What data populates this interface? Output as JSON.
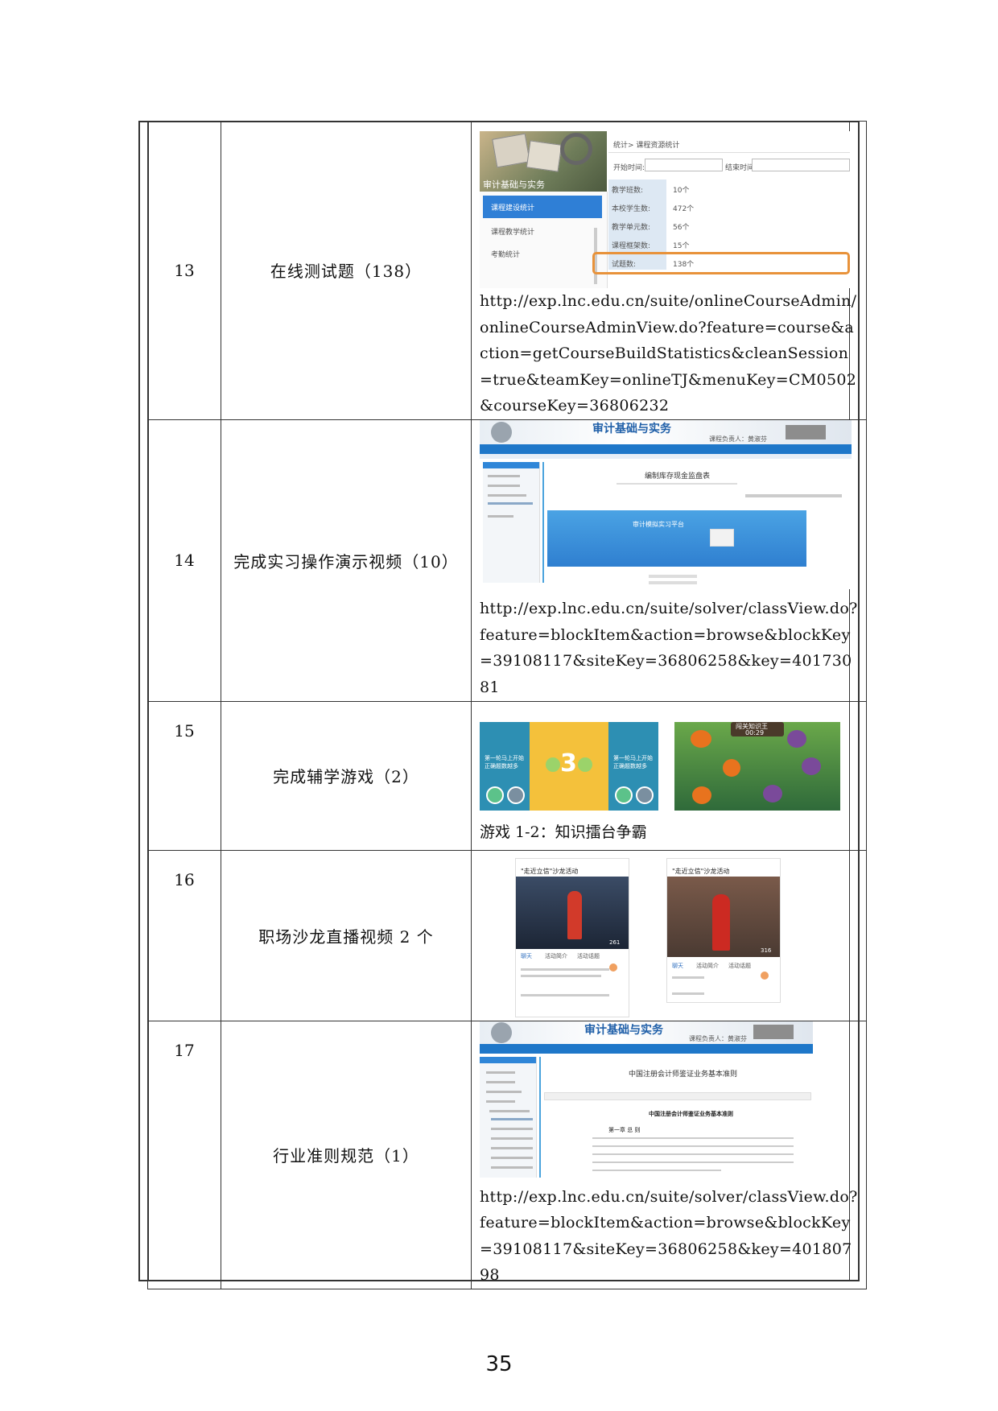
{
  "page_number": "35",
  "rows": [
    {
      "num": "13",
      "name": "在线测试题（138）",
      "url": "http://exp.lnc.edu.cn/suite/onlineCourseAdmin/onlineCourseAdminView.do?feature=course&action=getCourseBuildStatistics&cleanSession=true&teamKey=onlineTJ&menuKey=CM0502&courseKey=36806232",
      "screenshot": {
        "banner_title": "审计基础与实务",
        "menu": [
          "课程建设统计",
          "课程教学统计",
          "考勤统计"
        ],
        "breadcrumb": "统计> 课程资源统计",
        "start_label": "开始时间:",
        "end_label": "结束时间:",
        "stats": [
          {
            "label": "教学班数:",
            "value": "10个"
          },
          {
            "label": "本校学生数:",
            "value": "472个"
          },
          {
            "label": "教学单元数:",
            "value": "56个"
          },
          {
            "label": "课程框架数:",
            "value": "15个"
          },
          {
            "label": "试题数:",
            "value": "138个"
          }
        ],
        "highlight_color": "#e8923a"
      }
    },
    {
      "num": "14",
      "name": "完成实习操作演示视频（10）",
      "url": "http://exp.lnc.edu.cn/suite/solver/classView.do?feature=blockItem&action=browse&blockKey=39108117&siteKey=36806258&key=40173081",
      "screenshot": {
        "banner_title": "审计基础与实务",
        "owner": "课程负责人：黄淑芬",
        "article_title": "编制库存现金监盘表",
        "video_title": "审计模拟实习平台"
      }
    },
    {
      "num": "15",
      "name": "完成辅学游戏（2）",
      "caption": "游戏 1-2：知识擂台争霸",
      "screenshot": {
        "countdown": "3",
        "card_text": "第一轮马上开始 正确题数越多",
        "timer": "00:29",
        "title": "闯关知识王"
      }
    },
    {
      "num": "16",
      "name": "职场沙龙直播视频 2 个",
      "screenshot": {
        "live_title": "\"走近立信\"沙龙活动",
        "tabs": [
          "聊天",
          "活动简介",
          "活动话题"
        ],
        "viewers_a": "261",
        "viewers_b": "316"
      }
    },
    {
      "num": "17",
      "name": "行业准则规范（1）",
      "url": "http://exp.lnc.edu.cn/suite/solver/classView.do?feature=blockItem&action=browse&blockKey=39108117&siteKey=36806258&key=40180798",
      "screenshot": {
        "banner_title": "审计基础与实务",
        "owner": "课程负责人：黄淑芬",
        "article_title": "中国注册会计师鉴证业务基本准则",
        "doc_heading": "中国注册会计师鉴证业务基本准则",
        "chapter": "第一章 总 则"
      }
    }
  ]
}
